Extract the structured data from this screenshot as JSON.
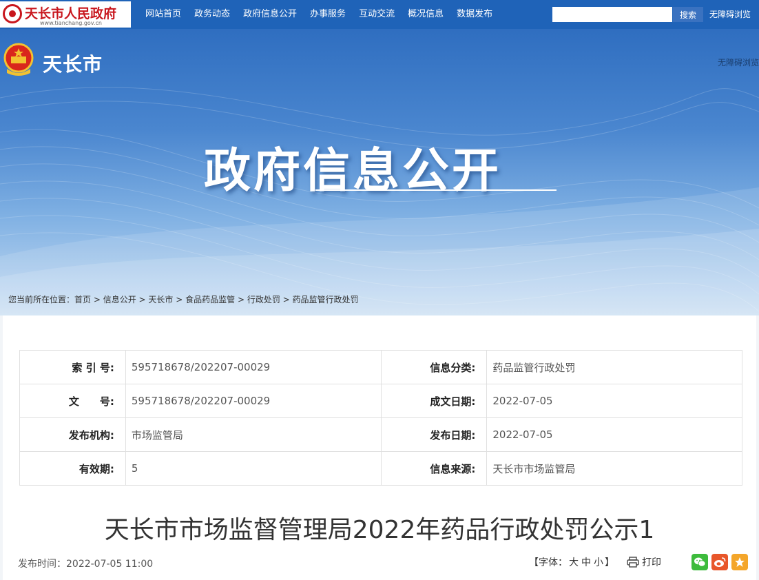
{
  "topbar": {
    "site_name": "天长市人民政府",
    "site_url": "www.tianchang.gov.cn",
    "nav": [
      "网站首页",
      "政务动态",
      "政府信息公开",
      "办事服务",
      "互动交流",
      "概况信息",
      "数据发布"
    ],
    "search_placeholder": "",
    "search_button": "搜索",
    "accessibility": "无障碍浏览"
  },
  "banner": {
    "city_name": "天长市",
    "accessibility": "无障碍浏览",
    "title": "政府信息公开"
  },
  "breadcrumb": {
    "prefix": "您当前所在位置：",
    "items": [
      "首页",
      "信息公开",
      "天长市",
      "食品药品监管",
      "行政处罚",
      "药品监管行政处罚"
    ],
    "separator": " > "
  },
  "meta": {
    "rows": [
      [
        {
          "label": "索 引 号:",
          "value": "595718678/202207-00029"
        },
        {
          "label": "信息分类:",
          "value": "药品监管行政处罚"
        }
      ],
      [
        {
          "label": "文　　号:",
          "value": "595718678/202207-00029"
        },
        {
          "label": "成文日期:",
          "value": "2022-07-05"
        }
      ],
      [
        {
          "label": "发布机构:",
          "value": "市场监管局"
        },
        {
          "label": "发布日期:",
          "value": "2022-07-05"
        }
      ],
      [
        {
          "label": "有效期:",
          "value": "5"
        },
        {
          "label": "信息来源:",
          "value": "天长市市场监管局"
        }
      ]
    ]
  },
  "article": {
    "title": "天长市市场监督管理局2022年药品行政处罚公示1",
    "pub_label": "发布时间：",
    "pub_time": "2022-07-05 11:00"
  },
  "tools": {
    "font_prefix": "【字体：",
    "font_large": "大",
    "font_medium": "中",
    "font_small": "小",
    "font_suffix": "】",
    "print": "打印"
  },
  "colors": {
    "nav_bg": "#1f63b8",
    "brand_red": "#c8161d",
    "wechat": "#3dbb3c",
    "weibo": "#e8562a",
    "favorite": "#f4a62a"
  }
}
